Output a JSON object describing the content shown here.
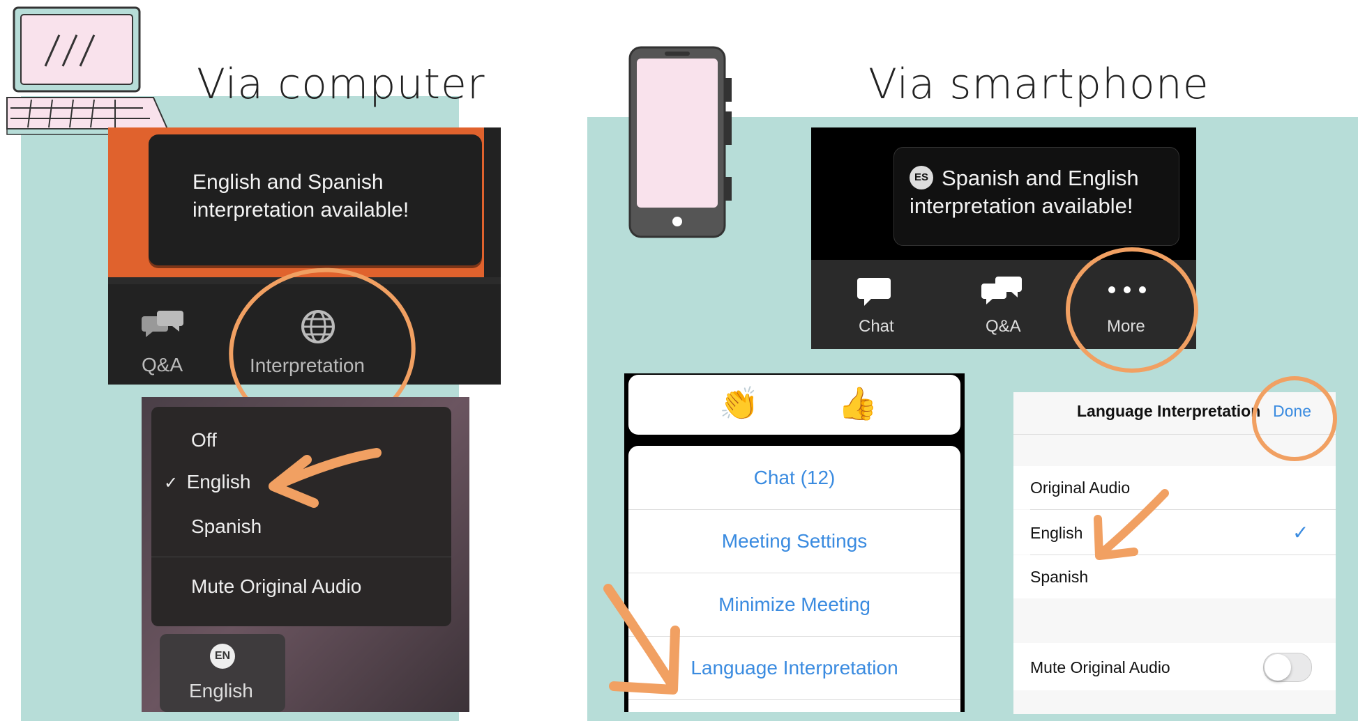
{
  "computer": {
    "heading": "Via computer",
    "tooltip": [
      "English and Spanish",
      "interpretation available!"
    ],
    "toolbar": {
      "qa_label": "Q&A",
      "interp_label": "Interpretation"
    },
    "menu": {
      "items": [
        "Off",
        "English",
        "Spanish",
        "Mute Original Audio"
      ],
      "checked": "English",
      "check_mark": "✓"
    },
    "lang_button": {
      "badge": "EN",
      "label": "English"
    }
  },
  "smartphone": {
    "heading": "Via smartphone",
    "tooltip": {
      "badge": "ES",
      "lines": [
        "Spanish and English",
        "interpretation available!"
      ]
    },
    "toolbar": {
      "chat": "Chat",
      "qa": "Q&A",
      "more": "More"
    },
    "reactions": [
      "👏",
      "👍"
    ],
    "more_menu": [
      "Chat (12)",
      "Meeting Settings",
      "Minimize Meeting",
      "Language Interpretation"
    ],
    "settings": {
      "title": "Language Interpretation",
      "done": "Done",
      "options": [
        "Original Audio",
        "English",
        "Spanish"
      ],
      "checked": "English",
      "check_mark": "✓",
      "mute_label": "Mute Original Audio",
      "mute_on": false
    }
  },
  "colors": {
    "accent": "#f1a062",
    "teal": "#b7ddd8",
    "ios_blue": "#3a8be0",
    "orange_bar": "#e0622d"
  }
}
